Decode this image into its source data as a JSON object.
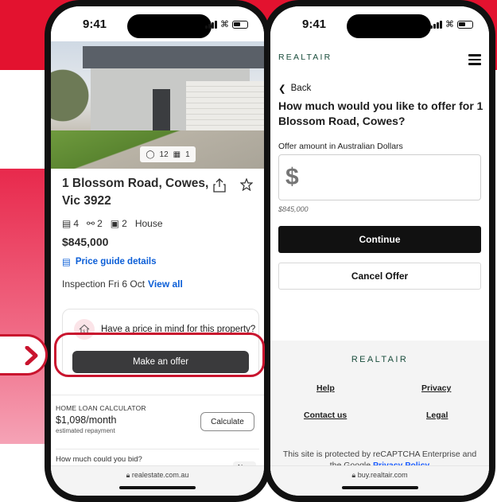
{
  "left_phone": {
    "status": {
      "time": "9:41"
    },
    "photos": {
      "photo_count": "12",
      "floorplan_count": "1"
    },
    "listing": {
      "address": "1 Blossom Road, Cowes, Vic 3922",
      "beds": "4",
      "baths": "2",
      "cars": "2",
      "type": "House",
      "price": "$845,000",
      "price_guide": "Price guide details",
      "inspection": "Inspection Fri 6 Oct",
      "view_all": "View all"
    },
    "offer_card": {
      "question": "Have a price in mind for this property?",
      "button": "Make an offer"
    },
    "loan": {
      "label": "HOME LOAN CALCULATOR",
      "amount": "$1,098",
      "period": "/month",
      "sub": "estimated repayment",
      "button": "Calculate"
    },
    "bid": {
      "label": "How much could you bid?",
      "badge": "New"
    },
    "url": "realestate.com.au"
  },
  "right_phone": {
    "status": {
      "time": "9:41"
    },
    "logo": "REALTAIR",
    "back": "Back",
    "question": "How much would you like to offer for 1 Blossom Road, Cowes?",
    "amount_label": "Offer amount in Australian Dollars",
    "amount_placeholder": "$",
    "amount_hint": "$845,000",
    "continue": "Continue",
    "cancel": "Cancel Offer",
    "footer": {
      "logo": "REALTAIR",
      "help": "Help",
      "privacy": "Privacy",
      "contact": "Contact us",
      "legal": "Legal",
      "captcha_text": "This site is protected by reCAPTCHA Enterprise and the Google",
      "privacy_policy": "Privacy Policy"
    },
    "url": "buy.realtair.com"
  },
  "colors": {
    "brand_red": "#e3122f",
    "link_blue": "#0b5ed7",
    "realtair_green": "#1a4d3c"
  }
}
